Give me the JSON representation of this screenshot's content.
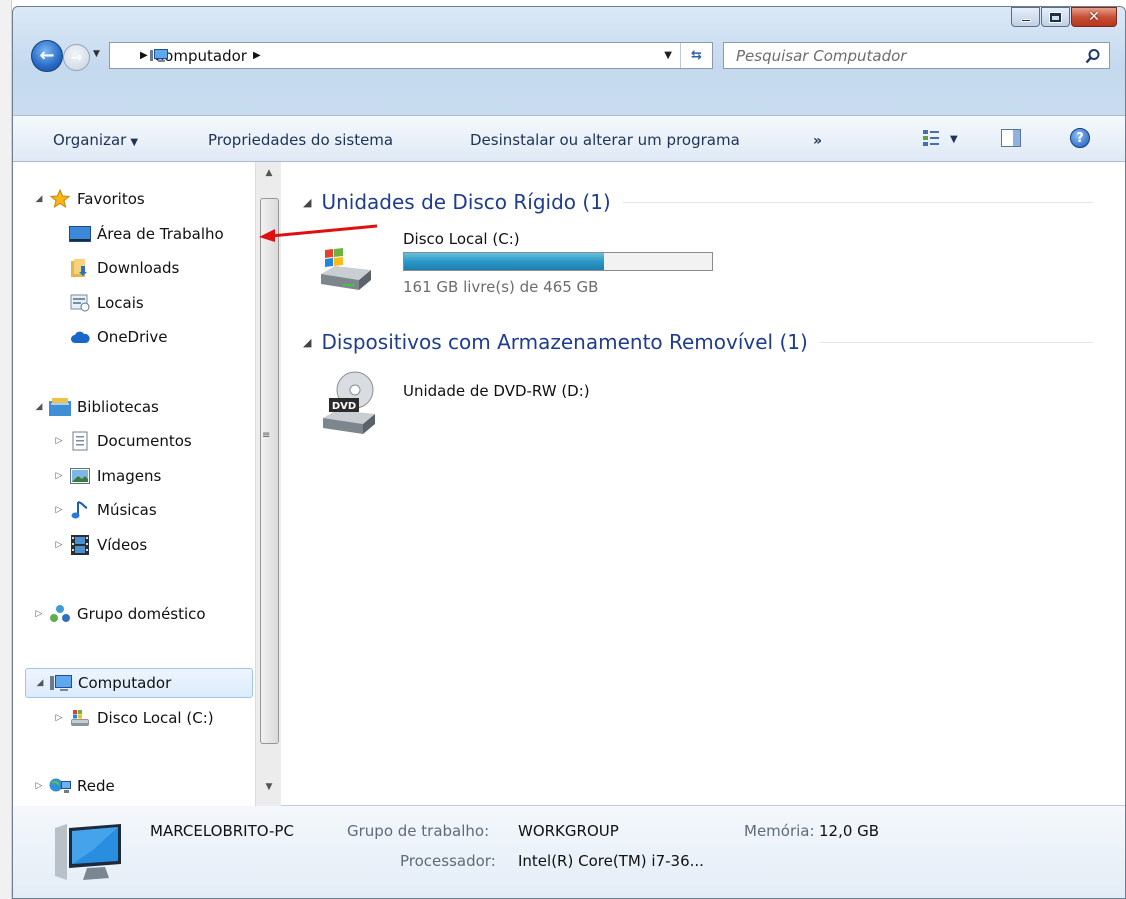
{
  "window": {
    "address_location": "Computador",
    "search_placeholder": "Pesquisar Computador"
  },
  "toolbar": {
    "organize": "Organizar",
    "system_properties": "Propriedades do sistema",
    "uninstall": "Desinstalar ou alterar um programa",
    "more": "»"
  },
  "sidebar": {
    "favorites": "Favoritos",
    "desktop": "Área de Trabalho",
    "downloads": "Downloads",
    "recent": "Locais",
    "onedrive": "OneDrive",
    "libraries": "Bibliotecas",
    "documents": "Documentos",
    "pictures": "Imagens",
    "music": "Músicas",
    "videos": "Vídeos",
    "homegroup": "Grupo doméstico",
    "computer": "Computador",
    "local_disk": "Disco Local (C:)",
    "network": "Rede"
  },
  "main": {
    "hdd_group": "Unidades de Disco Rígido (1)",
    "removable_group": "Dispositivos com Armazenamento Removível (1)",
    "drive_c": {
      "name": "Disco Local (C:)",
      "free_text": "161 GB livre(s) de 465 GB",
      "used_fraction": 0.65
    },
    "drive_d": {
      "name": "Unidade de DVD-RW (D:)",
      "badge": "DVD"
    }
  },
  "details": {
    "pc_name": "MARCELOBRITO-PC",
    "workgroup_label": "Grupo de trabalho:",
    "workgroup_value": "WORKGROUP",
    "memory_label": "Memória:",
    "memory_value": "12,0 GB",
    "processor_label": "Processador:",
    "processor_value": "Intel(R) Core(TM) i7-36..."
  },
  "colors": {
    "accent": "#1e3d8c",
    "annotation_arrow": "#e01010",
    "capacity_bar": "#2a98c7"
  }
}
